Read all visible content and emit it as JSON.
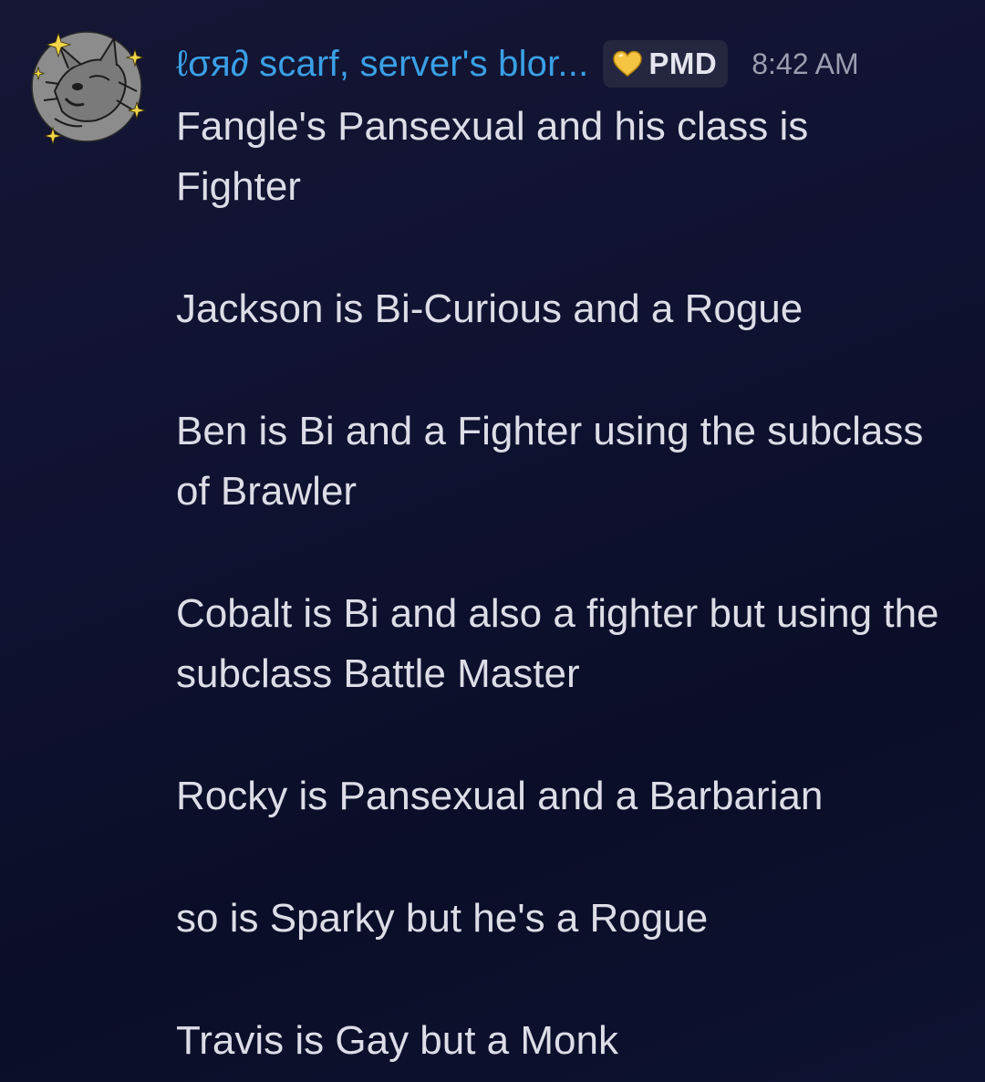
{
  "message": {
    "author": "ℓσя∂ scarf, server's blor...",
    "tag": {
      "icon": "gold-heart-icon",
      "label": "PMD"
    },
    "timestamp": "8:42 AM",
    "avatar_icon": "dark-pokemon-with-sparkles-avatar",
    "paragraphs": [
      "Fangle's Pansexual and his class is Fighter",
      "Jackson is Bi-Curious and a Rogue",
      "Ben is Bi and a Fighter using the subclass of Brawler",
      "Cobalt is Bi and also a fighter but using the subclass Battle Master",
      "Rocky is Pansexual and a Barbarian",
      "so is Sparky but he's a Rogue",
      "Travis is Gay but a Monk"
    ]
  },
  "colors": {
    "background": "#0f1230",
    "username": "#3aa0e6",
    "text": "#dcdde6",
    "timestamp": "#9b9db0",
    "tag_bg": "#24273f",
    "heart": "#f5c542"
  }
}
